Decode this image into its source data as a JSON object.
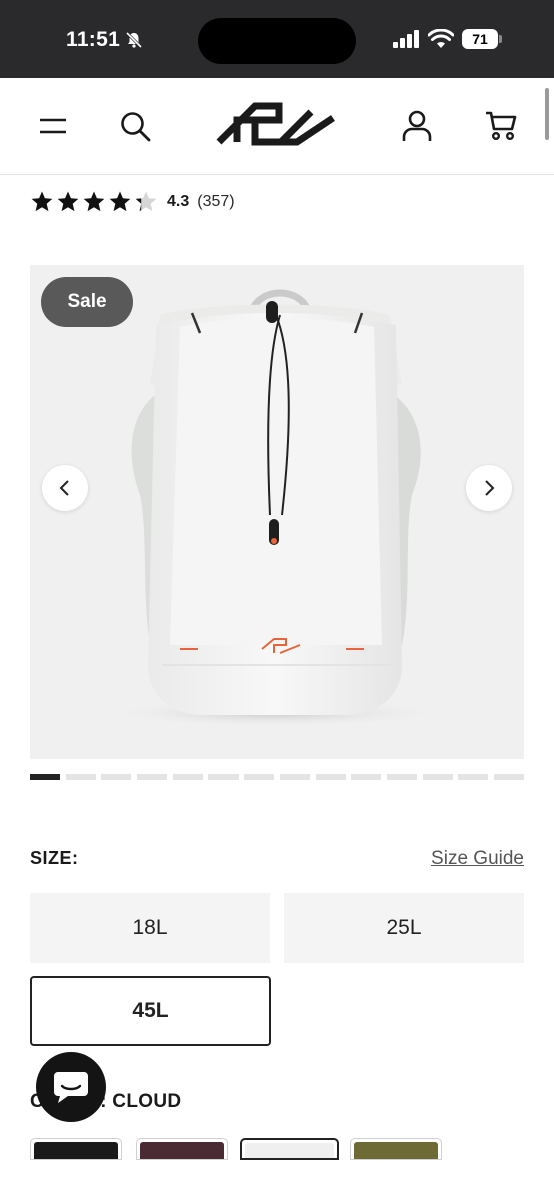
{
  "status_bar": {
    "time": "11:51",
    "battery": "71"
  },
  "header": {
    "brand": "pd"
  },
  "rating": {
    "value": "4.3",
    "count": "(357)",
    "stars": 4.3
  },
  "gallery": {
    "badge": "Sale",
    "image_count": 14,
    "active_index": 0,
    "accent_color": "#e8643a"
  },
  "size": {
    "label": "SIZE:",
    "guide_link": "Size Guide",
    "options": [
      "18L",
      "25L",
      "45L"
    ],
    "selected": "45L"
  },
  "color": {
    "label": "COLOR: CLOUD",
    "swatches": [
      "#1a1a1a",
      "#4a2a33",
      "#efefef",
      "#6e6a35"
    ],
    "selected_index": 2
  }
}
